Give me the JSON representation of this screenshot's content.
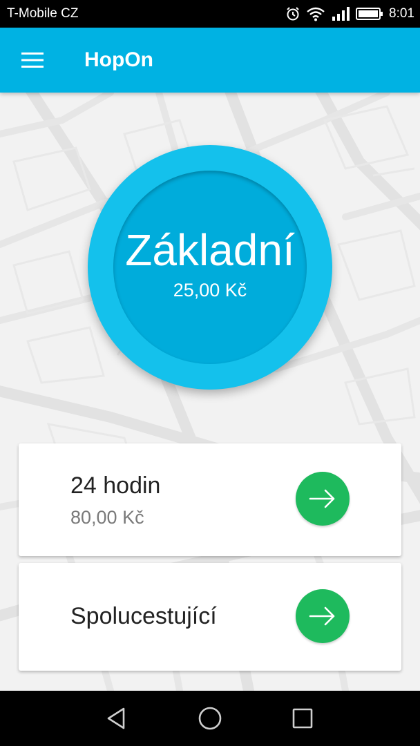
{
  "status_bar": {
    "carrier": "T-Mobile CZ",
    "time": "8:01",
    "icons": [
      "alarm-icon",
      "wifi-icon",
      "signal-icon",
      "battery-icon"
    ]
  },
  "app_bar": {
    "title": "HopOn",
    "menu_icon": "hamburger-menu-icon"
  },
  "selected_tariff": {
    "name": "Základní",
    "price": "25,00 Kč"
  },
  "tariff_options": [
    {
      "title": "24 hodin",
      "price": "80,00 Kč",
      "action_icon": "arrow-right-icon"
    },
    {
      "title": "Spolucestující",
      "action_icon": "arrow-right-icon"
    }
  ],
  "navigation_bar": {
    "buttons": [
      "back-icon",
      "home-icon",
      "recents-icon"
    ]
  },
  "colors": {
    "app_bar": "#00b2e3",
    "circle_outer": "#14c1ec",
    "circle_inner": "#00acdb",
    "action_button": "#1eba5d"
  }
}
